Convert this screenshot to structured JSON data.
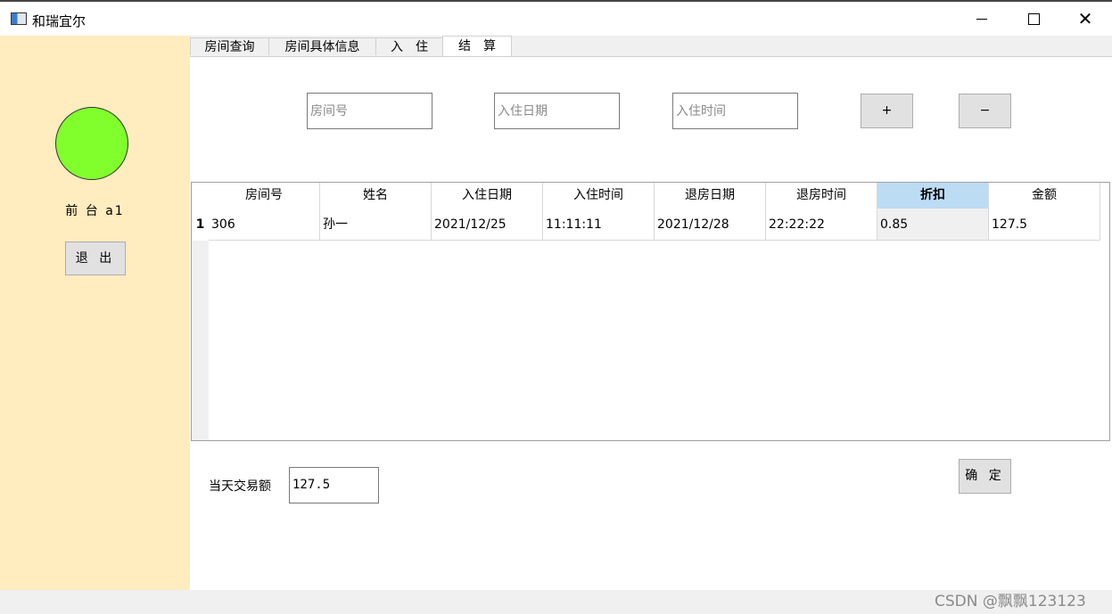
{
  "window": {
    "title": "和瑞宜尔"
  },
  "sidebar": {
    "user_label": "前 台 a1",
    "logout_label": "退 出",
    "status_color": "#80ff2d"
  },
  "tabs": [
    {
      "label": "房间查询"
    },
    {
      "label": "房间具体信息"
    },
    {
      "label": "入　住"
    },
    {
      "label": "结　算"
    }
  ],
  "form": {
    "room_placeholder": "房间号",
    "date_placeholder": "入住日期",
    "time_placeholder": "入住时间",
    "add_label": "+",
    "remove_label": "−"
  },
  "table": {
    "headers": [
      "房间号",
      "姓名",
      "入住日期",
      "入住时间",
      "退房日期",
      "退房时间",
      "折扣",
      "金额"
    ],
    "rows": [
      {
        "num": "1",
        "cells": [
          "306",
          "孙一",
          "2021/12/25",
          "11:11:11",
          "2021/12/28",
          "22:22:22",
          "0.85",
          "127.5"
        ]
      }
    ]
  },
  "bottom": {
    "total_label": "当天交易额",
    "total_value": "127.5",
    "confirm_label": "确 定"
  },
  "watermark": "CSDN @飘飘123123",
  "colors": {
    "sidebar_bg": "#ffecbf",
    "selected_header": "#bcdcf4"
  }
}
